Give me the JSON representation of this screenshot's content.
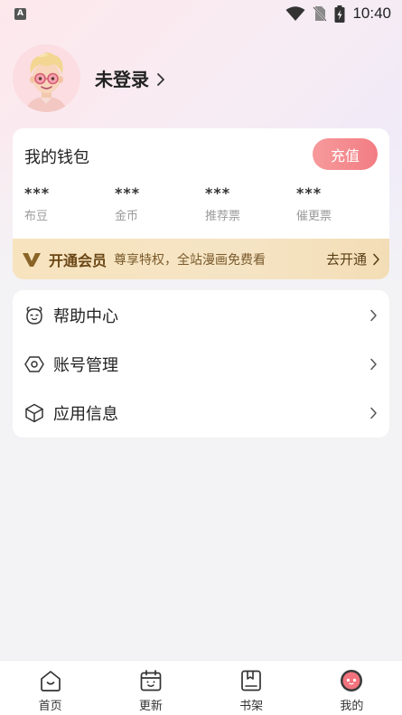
{
  "status_bar": {
    "app_badge": "A",
    "time": "10:40"
  },
  "profile": {
    "login_label": "未登录"
  },
  "wallet": {
    "title": "我的钱包",
    "recharge_label": "充值",
    "stats": [
      {
        "value": "***",
        "label": "布豆"
      },
      {
        "value": "***",
        "label": "金币"
      },
      {
        "value": "***",
        "label": "推荐票"
      },
      {
        "value": "***",
        "label": "催更票"
      }
    ]
  },
  "vip": {
    "title": "开通会员",
    "description": "尊享特权，全站漫画免费看",
    "action": "去开通"
  },
  "menu": {
    "items": [
      {
        "label": "帮助中心",
        "icon": "help-face-icon"
      },
      {
        "label": "账号管理",
        "icon": "hexagon-settings-icon"
      },
      {
        "label": "应用信息",
        "icon": "cube-icon"
      }
    ]
  },
  "nav": {
    "items": [
      {
        "label": "首页",
        "icon": "home-icon"
      },
      {
        "label": "更新",
        "icon": "calendar-icon"
      },
      {
        "label": "书架",
        "icon": "bookshelf-icon"
      },
      {
        "label": "我的",
        "icon": "profile-face-icon"
      }
    ],
    "active_color": "#f2737d"
  },
  "colors": {
    "accent": "#f27d83",
    "vip_gold": "#f5e4c4",
    "vip_text": "#6b4716"
  }
}
